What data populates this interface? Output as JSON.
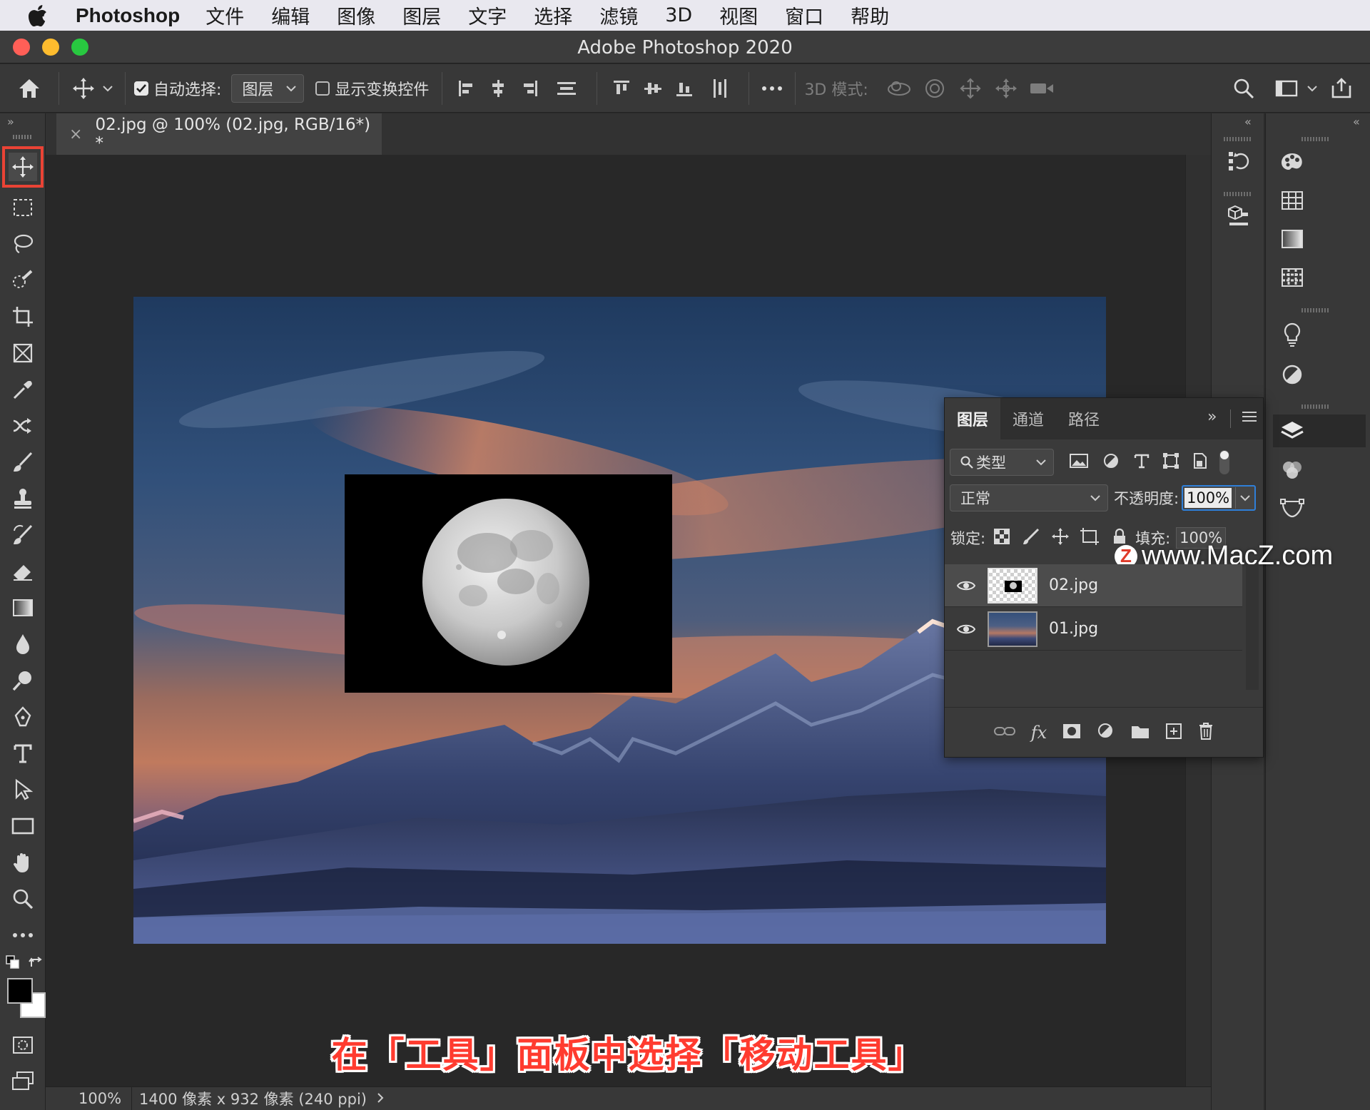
{
  "menubar": {
    "app_name": "Photoshop",
    "items": [
      "文件",
      "编辑",
      "图像",
      "图层",
      "文字",
      "选择",
      "滤镜",
      "3D",
      "视图",
      "窗口",
      "帮助"
    ]
  },
  "window": {
    "title": "Adobe Photoshop 2020",
    "traffic_lights": [
      "#ff5f57",
      "#febc2e",
      "#28c840"
    ]
  },
  "options": {
    "auto_select_label": "自动选择:",
    "auto_select_checked": true,
    "auto_select_target": "图层",
    "show_transform_label": "显示变换控件",
    "show_transform_checked": false,
    "mode_3d_label": "3D 模式:"
  },
  "document": {
    "tab_title": "02.jpg @ 100% (02.jpg, RGB/16*) *",
    "close_glyph": "×"
  },
  "toolbar": {
    "active_tool": "move-tool",
    "foreground_color": "#000000",
    "background_color": "#ffffff"
  },
  "layers_panel": {
    "tabs": [
      "图层",
      "通道",
      "路径"
    ],
    "active_tab": "图层",
    "filter_label": "类型",
    "blend_mode": "正常",
    "opacity_label": "不透明度:",
    "opacity_value": "100%",
    "lock_label": "锁定:",
    "fill_label": "填充:",
    "fill_value": "100%",
    "layers": [
      {
        "name": "02.jpg",
        "selected": true,
        "visible": true
      },
      {
        "name": "01.jpg",
        "selected": false,
        "visible": true
      }
    ]
  },
  "watermark": {
    "logo": "Z",
    "text": "www.MacZ.com"
  },
  "caption": "在「工具」面板中选择「移动工具」",
  "status": {
    "zoom": "100%",
    "doc_info": "1400 像素 x 932 像素 (240 ppi)"
  }
}
